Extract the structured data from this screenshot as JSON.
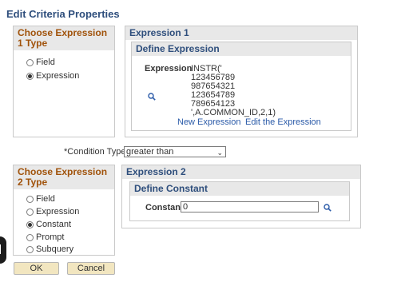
{
  "page": {
    "title": "Edit Criteria Properties"
  },
  "expr1_type": {
    "header": "Choose Expression 1 Type",
    "options": [
      "Field",
      "Expression"
    ],
    "selected": "Expression"
  },
  "expr1": {
    "header": "Expression 1",
    "define_header": "Define Expression",
    "label": "Expression",
    "lines": [
      "INSTR('",
      "123456789",
      "987654321",
      "123654789",
      "789654123",
      "',A.COMMON_ID,2,1)"
    ],
    "new_link": "New Expression",
    "edit_link": "Edit the Expression",
    "icon": "search-icon"
  },
  "condition": {
    "label": "*Condition Type",
    "value": "greater than",
    "icon": "chevron-down-icon"
  },
  "expr2_type": {
    "header": "Choose Expression 2 Type",
    "options": [
      "Field",
      "Expression",
      "Constant",
      "Prompt",
      "Subquery"
    ],
    "selected": "Constant"
  },
  "expr2": {
    "header": "Expression 2",
    "define_header": "Define Constant",
    "constant_label": "Constant",
    "constant_value": "0",
    "icon": "search-icon"
  },
  "buttons": {
    "ok": "OK",
    "cancel": "Cancel"
  }
}
